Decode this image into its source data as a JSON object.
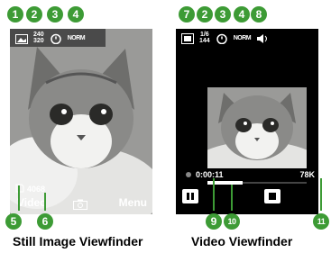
{
  "colors": {
    "callout": "#3d9b35",
    "screen_bg": "#000000"
  },
  "still": {
    "size_top": "240",
    "size_bottom": "320",
    "quality": "NORM",
    "memory_label": "4068",
    "left_softkey": "Video",
    "right_softkey": "Menu",
    "caption": "Still Image Viewfinder",
    "callouts": [
      "1",
      "2",
      "3",
      "4",
      "5",
      "6"
    ]
  },
  "video": {
    "size_top": "1/6",
    "size_bottom": "144",
    "quality": "NORM",
    "recording_time": "0:00:11",
    "file_size": "78K",
    "progress": 0.35,
    "caption": "Video Viewfinder",
    "callouts": [
      "7",
      "2",
      "3",
      "4",
      "8",
      "9",
      "10",
      "11"
    ]
  },
  "icons": [
    "image-mode-icon",
    "timer-icon",
    "speaker-icon",
    "memory-card-icon",
    "camera-icon",
    "pause-icon",
    "stop-icon"
  ]
}
